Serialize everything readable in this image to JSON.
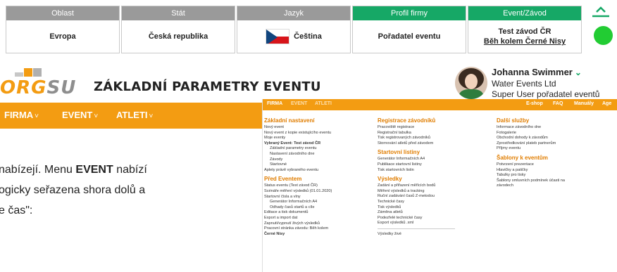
{
  "topbar": {
    "cells": [
      {
        "header": "Oblast",
        "value": "Evropa"
      },
      {
        "header": "Stát",
        "value": "Česká republika"
      },
      {
        "header": "Jazyk",
        "value": "Čeština"
      },
      {
        "header": "Profil firmy",
        "value": "Pořadatel eventu"
      },
      {
        "header": "Event/Závod",
        "value_line1": "Test závod ČR",
        "value_line2": "Běh kolem Černé Nisy"
      }
    ],
    "header_gray": "#9a9a9a",
    "header_green": "#16a866",
    "status_color": "#22cc33"
  },
  "logo": {
    "part1": "ORG",
    "part2": "SU"
  },
  "page_title": "ZÁKLADNÍ PARAMETRY EVENTU",
  "user": {
    "name": "Johanna Swimmer",
    "company": "Water Events Ltd",
    "role": "Super User pořadatel eventů"
  },
  "main_menu": {
    "color": "#f39c12",
    "items": [
      "FIRMA",
      "EVENT",
      "ATLETI"
    ]
  },
  "doc_lines": [
    {
      "pre": "nabízejí.  Menu ",
      "bold": "EVENT",
      "post": " nabízí"
    },
    {
      "pre": "ogicky seřazena shora dolů a",
      "bold": "",
      "post": ""
    },
    {
      "pre": "e čas\":",
      "bold": "",
      "post": ""
    }
  ],
  "mega_menu": {
    "bar_left": [
      "FIRMA",
      "EVENT",
      "ATLETI"
    ],
    "bar_right": [
      "E-shop",
      "FAQ",
      "Manuály",
      "Age"
    ],
    "col1": {
      "h1": "Základní nastavení",
      "items1": [
        "Nový event",
        "Nový event z kopie existujícího eventu",
        "Moje eventy",
        "Vybraný Event: Test závod ČR",
        "Základní parametry eventu",
        "Nastavení závodního dne",
        "Závody",
        "Startovné",
        "Aplety právě vybraného eventu"
      ],
      "h2": "Před Eventem",
      "items2": [
        "Status eventu (Test závod ČR)",
        "Scénáře měření výsledků (01.01.2020)",
        "Startovní čísla a vlny",
        "Generátor Informačních A4",
        "Odhady časů startů a cíle",
        "Editace a tisk dokumentů",
        "Export a import dat",
        "Zapnutí/vypnutí živých výsledků",
        "Pracovní stránka závodu: Běh kolem",
        "Černé Nisy"
      ]
    },
    "col2": {
      "h1": "Registrace závodníků",
      "items1": [
        "Pracoviště registrace",
        "Registrační tabulka",
        "Tisk registrovaných závodníků",
        "Stornování atletů před závodem"
      ],
      "h2": "Startovní listiny",
      "items2": [
        "Generátor Informačních A4",
        "Publikace startovní listiny",
        "Tisk startovních listin"
      ],
      "h3": "Výsledky",
      "items3": [
        "Zadání a přiřazení měřících bodů",
        "Měření výsledků a tracking",
        "Ruční zadávání časů Z-metodou",
        "Technické časy",
        "Tisk výsledků",
        "Záměna atletů",
        "Podezřelé technické časy",
        "Export výsledků .xml"
      ],
      "items4": [
        "Výsledky živé"
      ]
    },
    "col3": {
      "h1": "Další služby",
      "items1": [
        "Informace závodního dne",
        "Fotogalerie",
        "Obchodní dohody k závodům",
        "Zprostředkování plateb partnerům",
        "Příjmy eventu"
      ],
      "h2": "Šablony k eventům",
      "items2": [
        "Potvrzení prezentace",
        "Hlavičky a patičky",
        "Tabulky pro tisky",
        "Šablony smluvních podmínek účasti na",
        "závodech"
      ]
    }
  }
}
